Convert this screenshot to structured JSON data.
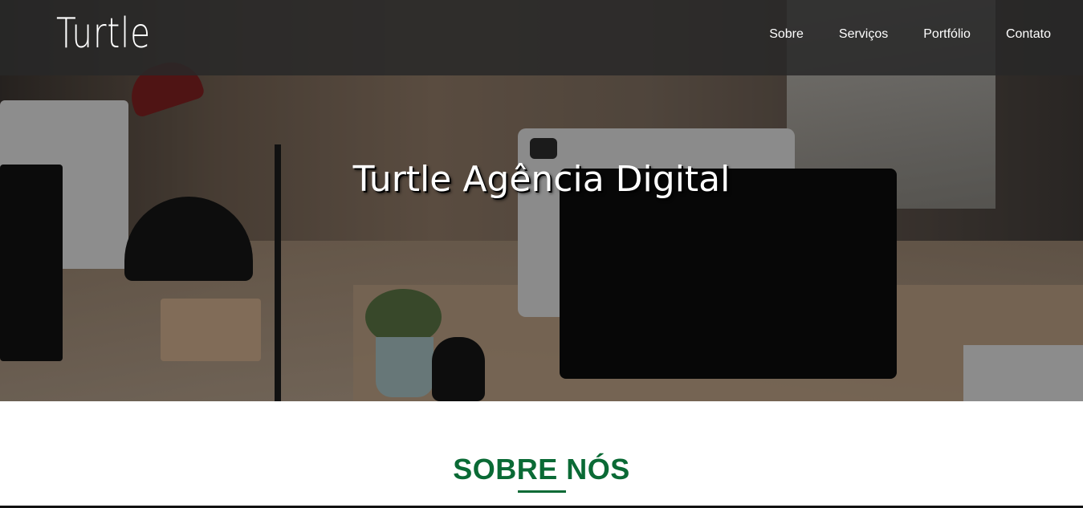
{
  "brand": {
    "logo_text": "Turtle"
  },
  "nav": {
    "items": [
      {
        "label": "Sobre"
      },
      {
        "label": "Serviços"
      },
      {
        "label": "Portfólio"
      },
      {
        "label": "Contato"
      }
    ]
  },
  "hero": {
    "title": "Turtle Agência Digital"
  },
  "about": {
    "heading": "SOBRE NÓS"
  },
  "colors": {
    "accent_green": "#0a6a35",
    "navbar_bg": "#282828"
  }
}
